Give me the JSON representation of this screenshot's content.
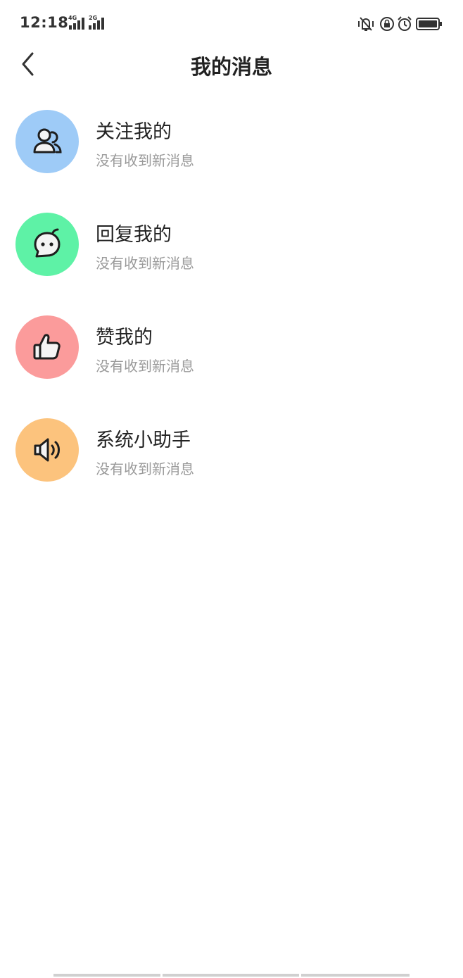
{
  "status_bar": {
    "time": "12:18",
    "signal1_label": "4G",
    "signal2_label": "2G"
  },
  "header": {
    "title": "我的消息"
  },
  "messages": [
    {
      "title": "关注我的",
      "subtitle": "没有收到新消息",
      "icon": "users-icon",
      "color": "#9ecbf7"
    },
    {
      "title": "回复我的",
      "subtitle": "没有收到新消息",
      "icon": "chat-bubble-icon",
      "color": "#5ef2a6"
    },
    {
      "title": "赞我的",
      "subtitle": "没有收到新消息",
      "icon": "thumbs-up-icon",
      "color": "#fb9b9b"
    },
    {
      "title": "系统小助手",
      "subtitle": "没有收到新消息",
      "icon": "speaker-icon",
      "color": "#fcc37d"
    }
  ]
}
